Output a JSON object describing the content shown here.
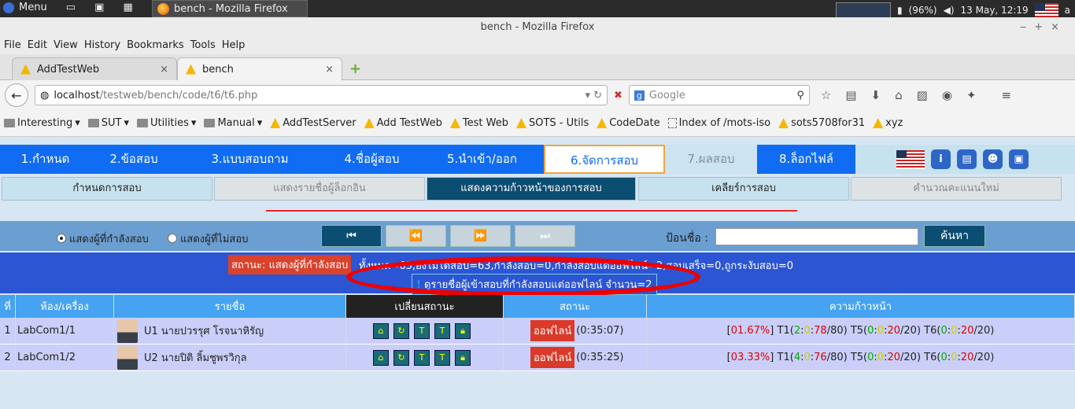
{
  "taskbar": {
    "menu": "Menu",
    "window_title": "bench - Mozilla Firefox",
    "battery": "(96%)",
    "clock": "13 May, 12:19",
    "user_initial": "a"
  },
  "window": {
    "title": "bench - Mozilla Firefox"
  },
  "menubar": [
    "File",
    "Edit",
    "View",
    "History",
    "Bookmarks",
    "Tools",
    "Help"
  ],
  "tabs": [
    {
      "label": "AddTestWeb"
    },
    {
      "label": "bench"
    }
  ],
  "address": {
    "host": "localhost",
    "path": "/testweb/bench/code/t6/t6.php"
  },
  "search": {
    "placeholder": "Google"
  },
  "bookmarks": [
    {
      "label": "Interesting",
      "type": "folder"
    },
    {
      "label": "SUT",
      "type": "folder"
    },
    {
      "label": "Utilities",
      "type": "folder"
    },
    {
      "label": "Manual",
      "type": "folder"
    },
    {
      "label": "AddTestServer",
      "type": "link"
    },
    {
      "label": "Add TestWeb",
      "type": "link"
    },
    {
      "label": "Test Web",
      "type": "link"
    },
    {
      "label": "SOTS - Utils",
      "type": "link"
    },
    {
      "label": "CodeDate",
      "type": "link"
    },
    {
      "label": "Index of /mots-iso",
      "type": "link"
    },
    {
      "label": "sots5708for31",
      "type": "link"
    },
    {
      "label": "xyz",
      "type": "link"
    }
  ],
  "mainnav": [
    "1.กำหนด",
    "2.ข้อสอบ",
    "3.แบบสอบถาม",
    "4.ชื่อผู้สอบ",
    "5.นำเข้า/ออก",
    "6.จัดการสอบ",
    "7.ผลสอบ",
    "8.ล็อกไฟล์"
  ],
  "subnav": [
    "กำหนดการสอบ",
    "แสดงรายชื่อผู้ล็อกอิน",
    "แสดงความก้าวหน้าของการสอบ",
    "เคลียร์การสอบ",
    "คำนวณคะแนนใหม่"
  ],
  "filter": {
    "radio_online": "แสดงผู้ที่กำลังสอบ",
    "radio_offline": "แสดงผู้ที่ไม่สอบ",
    "name_label": "ป้อนชื่อ :",
    "search_button": "ค้นหา"
  },
  "status": {
    "badge": "สถานะ: แสดงผู้ที่กำลังสอบ",
    "summary": "ทั้งหมด=65,ยังไม่ได้สอบ=63,กำลังสอบ=0,กำลังสอบแต่ออฟไลน์=2,สอบเสร็จ=0,ถูกระงับสอบ=0",
    "offline_link": "ดูรายชื่อผู้เข้าสอบที่กำลังสอบแต่ออฟไลน์ จำนวน=2"
  },
  "table": {
    "headers": [
      "ที่",
      "ห้อง/เครื่อง",
      "รายชื่อ",
      "เปลี่ยนสถานะ",
      "สถานะ",
      "ความก้าวหน้า"
    ],
    "rows": [
      {
        "no": "1",
        "room": "LabCom1/1",
        "name": "U1 นายปวรรุศ โรจนาหิรัญ",
        "status": "ออฟไลน์",
        "time": "(0:35:07)",
        "pct": "01.67%",
        "t1": [
          "T1(",
          "2",
          ":",
          "0",
          ":",
          "78",
          "/80)"
        ],
        "t5": [
          "T5(",
          "0",
          ":",
          "0",
          ":",
          "20",
          "/20)"
        ],
        "t6": [
          "T6(",
          "0",
          ":",
          "0",
          ":",
          "20",
          "/20)"
        ]
      },
      {
        "no": "2",
        "room": "LabCom1/2",
        "name": "U2 นายปิติ ลิ้มชูพรวิกุล",
        "status": "ออฟไลน์",
        "time": "(0:35:25)",
        "pct": "03.33%",
        "t1": [
          "T1(",
          "4",
          ":",
          "0",
          ":",
          "76",
          "/80)"
        ],
        "t5": [
          "T5(",
          "0",
          ":",
          "0",
          ":",
          "20",
          "/20)"
        ],
        "t6": [
          "T6(",
          "0",
          ":",
          "0",
          ":",
          "20",
          "/20)"
        ]
      }
    ]
  }
}
